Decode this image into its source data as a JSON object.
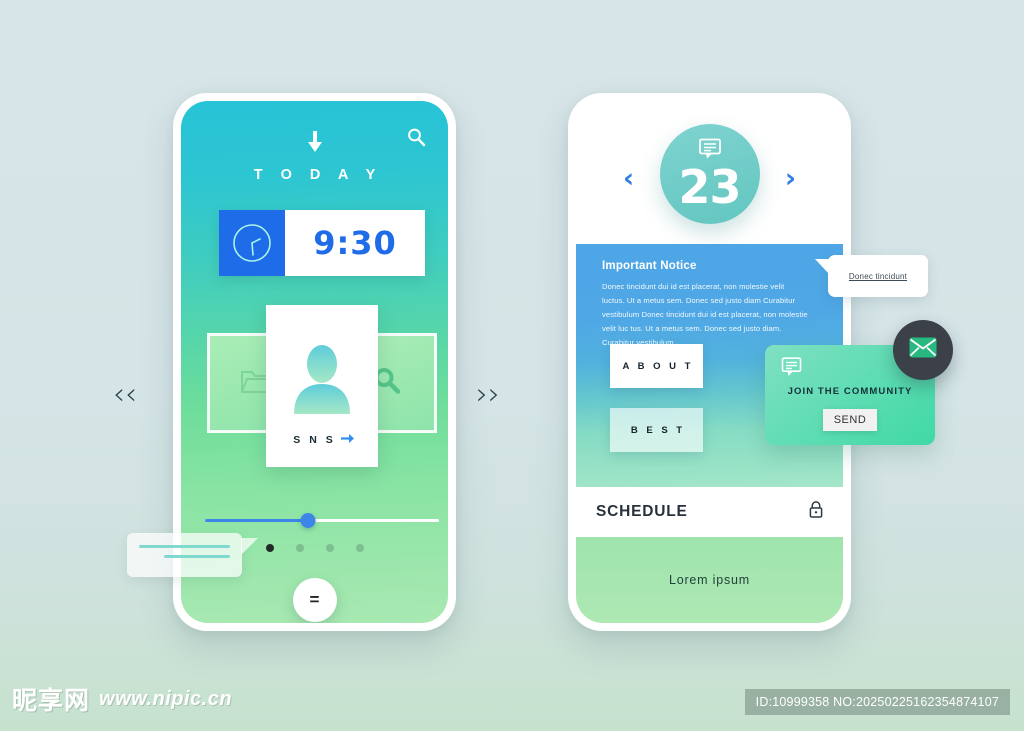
{
  "background_color": "#d6e5e7",
  "left_phone": {
    "header": {
      "down_arrow_icon": "arrow-down-icon",
      "search_icon": "search-icon",
      "title": "T O D A Y"
    },
    "clock_widget": {
      "icon": "clock-icon",
      "time": "9:30",
      "accent_color": "#1f6ce8"
    },
    "carousel": {
      "left_icon": "folder-icon",
      "right_icon": "search-icon",
      "card": {
        "avatar_icon": "user-avatar-icon",
        "label": "S N S",
        "arrow_icon": "arrow-right-icon"
      }
    },
    "slider": {
      "value_percent": 44
    },
    "pagination": {
      "count": 4,
      "active_index": 0
    },
    "menu_button_label": "=",
    "chat_bubble": {
      "lines": 2
    }
  },
  "pager": {
    "prev_label": "‹‹",
    "next_label": "››"
  },
  "right_phone": {
    "date_header": {
      "prev_label": "‹",
      "next_label": "›",
      "day_number": "23",
      "badge_icon": "chat-bubble-icon"
    },
    "notice": {
      "title": "Important Notice",
      "body": "Donec tincidunt dui id est placerat, non molestie velit luctus. Ut a metus sem. Donec sed justo diam Curabitur vestibulum Donec tincidunt dui id est placerat, non molestie velit luc tus. Ut a metus sem. Donec sed justo diam. Curabitur vestibulum",
      "buttons": [
        {
          "label": "A B O U T"
        },
        {
          "label": "B E S T"
        }
      ]
    },
    "schedule": {
      "title": "SCHEDULE",
      "lock_icon": "lock-icon",
      "footer_text": "Lorem ipsum"
    }
  },
  "overlays": {
    "tooltip": {
      "text": "Donec tincidunt"
    },
    "community_card": {
      "chat_icon": "chat-bubble-icon",
      "title": "JOIN THE COMMUNITY",
      "send_label": "SEND"
    },
    "mail_fab": {
      "icon": "mail-icon"
    }
  },
  "watermark": {
    "logo_text": "昵享网",
    "url": "www.nipic.cn",
    "id_text": "ID:10999358 NO:20250225162354874107"
  }
}
